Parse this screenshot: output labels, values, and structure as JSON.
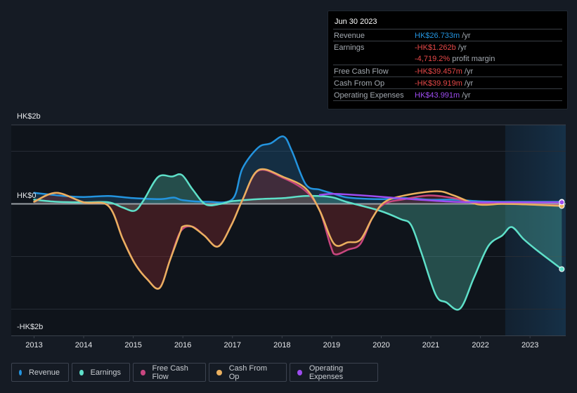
{
  "tooltip": {
    "date": "Jun 30 2023",
    "rows": [
      {
        "label": "Revenue",
        "value": "HK$26.733m",
        "unit": " /yr",
        "color": "#2394df"
      },
      {
        "label": "Earnings",
        "value": "-HK$1.262b",
        "unit": " /yr",
        "color": "#e64848"
      },
      {
        "label": "",
        "value": "-4,719.2%",
        "unit": " profit margin",
        "color": "#e64848"
      },
      {
        "label": "Free Cash Flow",
        "value": "-HK$39.457m",
        "unit": " /yr",
        "color": "#e64848"
      },
      {
        "label": "Cash From Op",
        "value": "-HK$39.919m",
        "unit": " /yr",
        "color": "#e64848"
      },
      {
        "label": "Operating Expenses",
        "value": "HK$43.991m",
        "unit": " /yr",
        "color": "#9d4cf0"
      }
    ]
  },
  "legend": [
    {
      "name": "Revenue",
      "color": "#2394df"
    },
    {
      "name": "Earnings",
      "color": "#5ee0c9"
    },
    {
      "name": "Free Cash Flow",
      "color": "#c8467f"
    },
    {
      "name": "Cash From Op",
      "color": "#eab05f"
    },
    {
      "name": "Operating Expenses",
      "color": "#9d4cf0"
    }
  ],
  "chart_data": {
    "type": "line",
    "title": "",
    "xlabel": "",
    "ylabel": "",
    "unit": "HK$ billions",
    "y_tick_labels": [
      "HK$2b",
      "HK$0",
      "-HK$2b"
    ],
    "x_tick_labels": [
      "2013",
      "2014",
      "2015",
      "2016",
      "2017",
      "2018",
      "2019",
      "2020",
      "2021",
      "2022",
      "2023"
    ],
    "x_range": [
      2012.54,
      2023.72
    ],
    "ylim": [
      -2.5,
      1.5
    ],
    "grid": true,
    "highlight_from": 2022.5,
    "legend_position": "bottom",
    "series": [
      {
        "name": "Revenue",
        "color": "#2394df",
        "fill": true,
        "x": [
          2013.0,
          2013.6,
          2014.0,
          2014.5,
          2015.0,
          2015.54,
          2015.82,
          2016.0,
          2016.5,
          2017.0,
          2017.2,
          2017.52,
          2017.77,
          2018.03,
          2018.2,
          2018.48,
          2018.76,
          2019.05,
          2019.33,
          2019.97,
          2020.47,
          2020.96,
          2021.46,
          2021.95,
          2022.44,
          2022.92,
          2023.64
        ],
        "y": [
          0.21,
          0.15,
          0.13,
          0.15,
          0.11,
          0.09,
          0.12,
          0.07,
          0.04,
          0.09,
          0.67,
          1.07,
          1.15,
          1.28,
          1.0,
          0.37,
          0.27,
          0.19,
          0.12,
          0.09,
          0.11,
          0.08,
          0.08,
          0.05,
          0.04,
          0.04,
          0.04
        ]
      },
      {
        "name": "Earnings",
        "color": "#5ee0c9",
        "fill": true,
        "x": [
          2013.0,
          2013.45,
          2014.0,
          2014.5,
          2014.79,
          2015.03,
          2015.21,
          2015.5,
          2015.78,
          2015.98,
          2016.2,
          2016.46,
          2016.77,
          2016.98,
          2017.52,
          2018.03,
          2018.48,
          2018.98,
          2019.33,
          2019.97,
          2020.39,
          2020.6,
          2020.81,
          2021.1,
          2021.31,
          2021.59,
          2021.87,
          2022.16,
          2022.44,
          2022.63,
          2022.87,
          2023.15,
          2023.64
        ],
        "y": [
          0.08,
          0.04,
          0.03,
          0.03,
          -0.07,
          -0.13,
          0.07,
          0.51,
          0.52,
          0.55,
          0.27,
          -0.01,
          0.0,
          0.05,
          0.09,
          0.11,
          0.15,
          0.13,
          0.03,
          -0.13,
          -0.29,
          -0.4,
          -0.93,
          -1.73,
          -1.87,
          -1.99,
          -1.4,
          -0.8,
          -0.6,
          -0.44,
          -0.67,
          -0.89,
          -1.24
        ]
      },
      {
        "name": "Free Cash Flow",
        "color": "#c8467f",
        "fill": true,
        "x": [
          2013.0,
          2013.45,
          2014.0,
          2014.5,
          2014.79,
          2015.03,
          2015.28,
          2015.53,
          2015.74,
          2015.95,
          2016.18,
          2016.43,
          2016.71,
          2016.98,
          2017.2,
          2017.52,
          2018.03,
          2018.48,
          2018.76,
          2018.98,
          2019.08,
          2019.33,
          2019.58,
          2019.82,
          2020.06,
          2020.47,
          2020.96,
          2021.46,
          2021.95,
          2022.44,
          2022.92,
          2023.64
        ],
        "y": [
          0.04,
          0.21,
          0.03,
          -0.04,
          -0.67,
          -1.13,
          -1.43,
          -1.6,
          -1.07,
          -0.53,
          -0.43,
          -0.6,
          -0.81,
          -0.4,
          0.07,
          0.63,
          0.49,
          0.24,
          -0.13,
          -0.8,
          -0.96,
          -0.87,
          -0.76,
          -0.27,
          0.0,
          0.09,
          0.16,
          0.11,
          0.0,
          0.0,
          -0.01,
          -0.03
        ]
      },
      {
        "name": "Cash From Op",
        "color": "#eab05f",
        "fill": false,
        "x": [
          2013.0,
          2013.45,
          2014.0,
          2014.5,
          2014.79,
          2015.03,
          2015.28,
          2015.53,
          2015.74,
          2015.95,
          2016.0,
          2016.18,
          2016.43,
          2016.71,
          2016.98,
          2017.2,
          2017.52,
          2018.03,
          2018.48,
          2018.76,
          2019.05,
          2019.33,
          2019.58,
          2019.82,
          2020.06,
          2020.47,
          2021.12,
          2021.46,
          2021.95,
          2022.44,
          2022.92,
          2023.64
        ],
        "y": [
          0.04,
          0.21,
          0.03,
          -0.04,
          -0.67,
          -1.13,
          -1.43,
          -1.6,
          -1.07,
          -0.53,
          -0.43,
          -0.43,
          -0.6,
          -0.81,
          -0.4,
          0.07,
          0.64,
          0.51,
          0.29,
          -0.13,
          -0.76,
          -0.73,
          -0.68,
          -0.27,
          0.03,
          0.16,
          0.24,
          0.16,
          -0.01,
          0.0,
          -0.01,
          -0.04
        ]
      },
      {
        "name": "Operating Expenses",
        "color": "#9d4cf0",
        "fill": false,
        "x": [
          2018.76,
          2019.05,
          2019.62,
          2020.19,
          2020.75,
          2021.46,
          2022.16,
          2022.92,
          2023.64
        ],
        "y": [
          0.17,
          0.19,
          0.16,
          0.12,
          0.08,
          0.04,
          0.03,
          0.03,
          0.03
        ]
      }
    ]
  }
}
